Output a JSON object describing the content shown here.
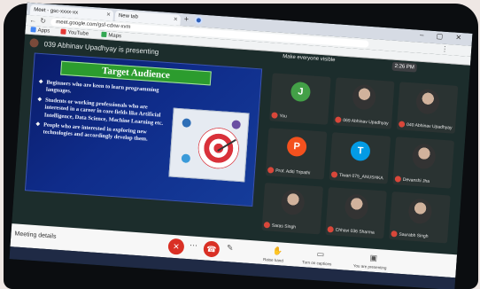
{
  "browser": {
    "tabs": [
      {
        "label": "Meet - gsc-xxxx-xx"
      },
      {
        "label": "New tab"
      }
    ],
    "new_tab_symbol": "+",
    "window_controls": "– ▢ ✕",
    "url": "meet.google.com/gsf-cdxw-xvm",
    "bookmarks": [
      {
        "label": "Apps",
        "color": "#4285f4"
      },
      {
        "label": "YouTube",
        "color": "#e53935"
      },
      {
        "label": "Maps",
        "color": "#34a853"
      }
    ]
  },
  "meet": {
    "presenter_text": "039 Abhinav Upadhyay is presenting",
    "top_right": {
      "share_text": "Make everyone visible",
      "time": "2:26 PM"
    },
    "slide": {
      "title": "Target Audience",
      "bullets": [
        "Beginners who are keen to learn programming languages.",
        "Students or working professionals who are interested in a career in core fields like Artificial Intelligence, Data Science, Machine Learning etc.",
        "People who are interested in exploring new technologies and accordingly develop them."
      ]
    },
    "participants": [
      {
        "name": "You",
        "initial": "J",
        "color": "#43a047",
        "type": "letter"
      },
      {
        "name": "069 Abhinav Upadhyay",
        "initial": "",
        "color": "#2a3332",
        "type": "photo"
      },
      {
        "name": "040 Abhinav Upadhyay",
        "initial": "",
        "color": "#2a3332",
        "type": "photo"
      },
      {
        "name": "Prof. Aditi Tripathi",
        "initial": "P",
        "color": "#f4511e",
        "type": "letter"
      },
      {
        "name": "Tiwari 075_ANUSHKA",
        "initial": "T",
        "color": "#039be5",
        "type": "letter"
      },
      {
        "name": "Devanshi Jha",
        "initial": "",
        "color": "#2a3332",
        "type": "photo"
      },
      {
        "name": "Saras Singh",
        "initial": "",
        "color": "#2a3332",
        "type": "photo"
      },
      {
        "name": "Chhavi 036 Sharma",
        "initial": "",
        "color": "#2a3332",
        "type": "photo"
      },
      {
        "name": "Saurabh Singh",
        "initial": "",
        "color": "#2a3332",
        "type": "photo"
      }
    ]
  },
  "controls": {
    "meeting_details": "Meeting details",
    "mic_icon": "mic-off-icon",
    "end_icon": "hang-up-icon",
    "cam_icon": "camera-off-icon",
    "actions": [
      {
        "label": "Raise hand"
      },
      {
        "label": "Turn on captions"
      },
      {
        "label": "You are presenting"
      }
    ]
  }
}
